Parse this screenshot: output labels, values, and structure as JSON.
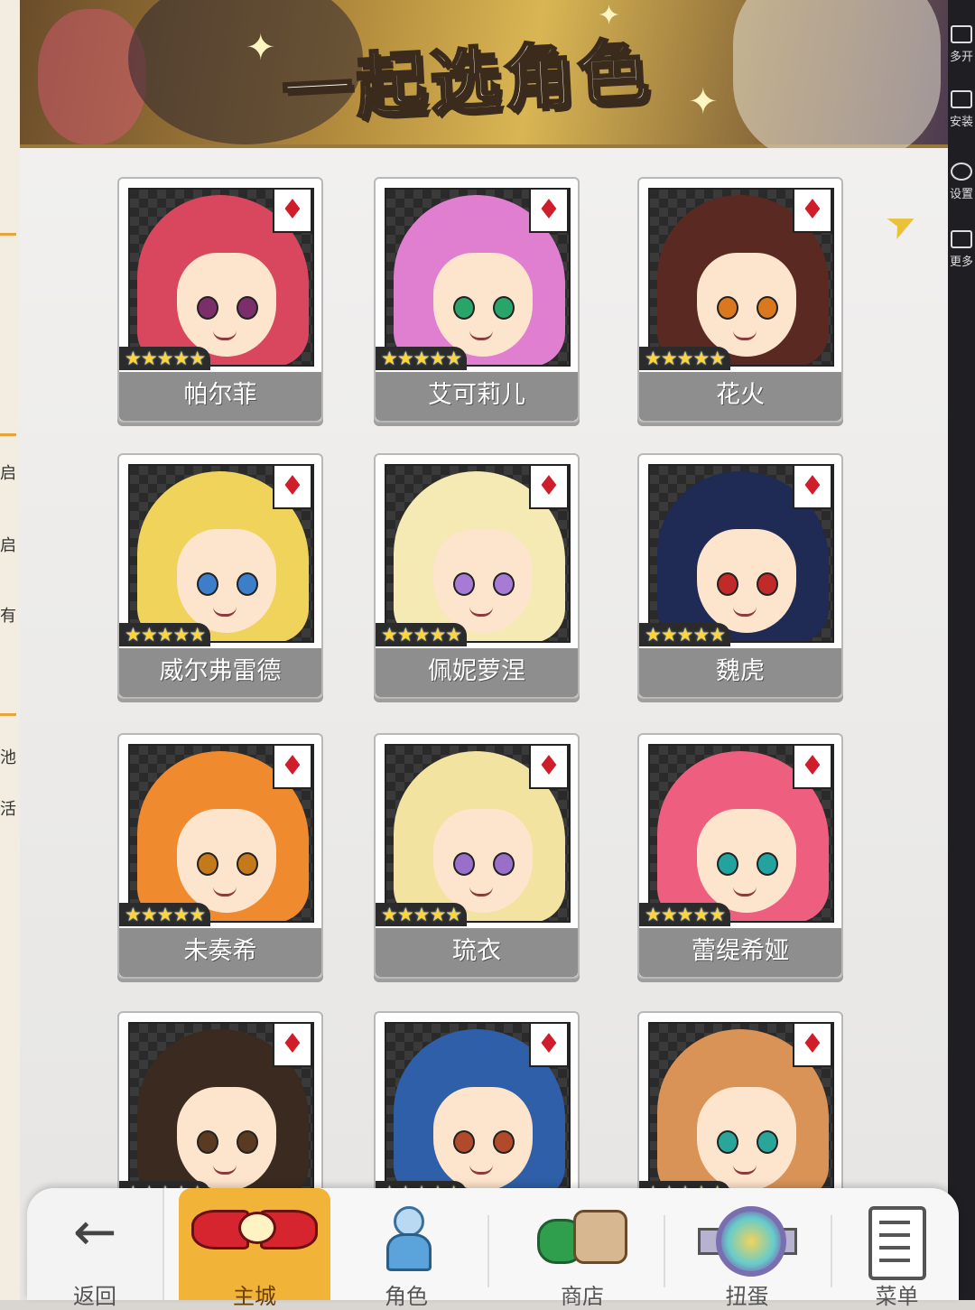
{
  "left_window": {
    "labels": [
      "启",
      "启",
      "有",
      "池",
      "活"
    ]
  },
  "right_toolbar": {
    "items": [
      {
        "label": "多开",
        "icon": "multi-instance-icon"
      },
      {
        "label": "安装",
        "icon": "install-icon"
      },
      {
        "label": "设置",
        "icon": "settings-icon"
      },
      {
        "label": "更多",
        "icon": "more-icon"
      }
    ]
  },
  "banner": {
    "title": "一起选角色"
  },
  "characters": [
    {
      "name": "帕尔菲",
      "stars": "★★★★★",
      "suit": "♦",
      "hair": "#d9475f",
      "eyes": "#7a2f6b"
    },
    {
      "name": "艾可莉儿",
      "stars": "★★★★★",
      "suit": "♦",
      "hair": "#e07fd0",
      "eyes": "#2aa56a"
    },
    {
      "name": "花火",
      "stars": "★★★★★",
      "suit": "♦",
      "hair": "#5a2a22",
      "eyes": "#d9781f"
    },
    {
      "name": "威尔弗雷德",
      "stars": "★★★★★",
      "suit": "♦",
      "hair": "#f0d35a",
      "eyes": "#3c7ec9"
    },
    {
      "name": "佩妮萝涅",
      "stars": "★★★★★",
      "suit": "♦",
      "hair": "#f5e9b4",
      "eyes": "#a77ad6"
    },
    {
      "name": "魏虎",
      "stars": "★★★★★",
      "suit": "♦",
      "hair": "#1f2a55",
      "eyes": "#c22a2a"
    },
    {
      "name": "未奏希",
      "stars": "★★★★★",
      "suit": "♦",
      "hair": "#f08a2e",
      "eyes": "#c47a1a"
    },
    {
      "name": "琉衣",
      "stars": "★★★★★",
      "suit": "♦",
      "hair": "#f3e3a0",
      "eyes": "#9a6fc9"
    },
    {
      "name": "蕾缇希娅",
      "stars": "★★★★★",
      "suit": "♦",
      "hair": "#ee5f7f",
      "eyes": "#22a3a0"
    },
    {
      "name": "",
      "stars": "★★★★★",
      "suit": "♦",
      "hair": "#3a2a20",
      "eyes": "#5a3a20"
    },
    {
      "name": "",
      "stars": "★★★★★",
      "suit": "♦",
      "hair": "#2e5fa8",
      "eyes": "#b04a2a"
    },
    {
      "name": "",
      "stars": "★★★★★",
      "suit": "♦",
      "hair": "#d99356",
      "eyes": "#2aa59a"
    }
  ],
  "bottom_nav": {
    "back_label": "返回",
    "back_icon": "←",
    "items": [
      {
        "label": "主城"
      },
      {
        "label": "角色"
      },
      {
        "label": "商店"
      },
      {
        "label": "扭蛋"
      },
      {
        "label": "菜单"
      }
    ]
  },
  "colors": {
    "suit_red": "#d01d2b",
    "active_tab": "#f1b338",
    "star_gold": "#ffd43b"
  }
}
